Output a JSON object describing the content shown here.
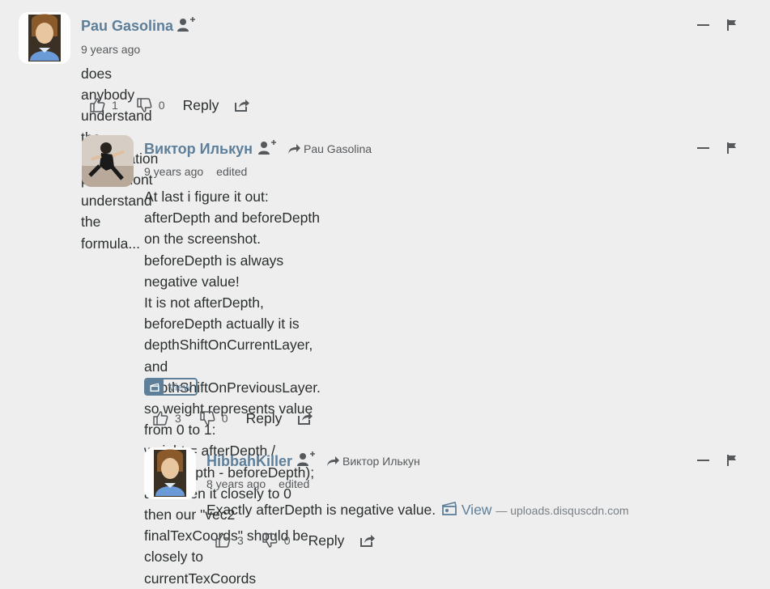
{
  "comments": [
    {
      "author": "Pau Gasolina",
      "time": "9 years ago",
      "edited": "",
      "reply_to": "",
      "lines": [
        "does anybody understand the interpolation part? I dont understand the formula..."
      ],
      "upvotes": "1",
      "downvotes": "0",
      "reply_label": "Reply"
    },
    {
      "author": "Виктор Илькун",
      "time": "9 years ago",
      "edited": "edited",
      "reply_to": "Pau Gasolina",
      "lines": [
        "At last i figure it out:",
        "afterDepth and beforeDepth on the screenshot.",
        "beforeDepth is always negative value!",
        "It is not afterDepth, beforeDepth actually it is depthShiftOnCurrentLayer, and",
        "depthShiftOnPreviousLayer.",
        "so weight represents value from 0 to 1:",
        "weight = afterDepth / (afterDepth - beforeDepth);",
        "and when it closely to 0 then our \"vec2 finalTexCoords\" should be closely to",
        "currentTexCoords"
      ],
      "view_label": "View",
      "upvotes": "3",
      "downvotes": "0",
      "reply_label": "Reply"
    },
    {
      "author": "HibbahKiller",
      "time": "8 years ago",
      "edited": "edited",
      "reply_to": "Виктор Илькун",
      "text": "Exactly afterDepth is negative value.",
      "view_label": "View",
      "view_host": "— uploads.disquscdn.com",
      "upvotes": "3",
      "downvotes": "0",
      "reply_label": "Reply"
    }
  ],
  "colors": {
    "background": "#eeeeee",
    "author": "#5d7f9a",
    "text": "#2a2e2e",
    "muted": "#55595c"
  }
}
